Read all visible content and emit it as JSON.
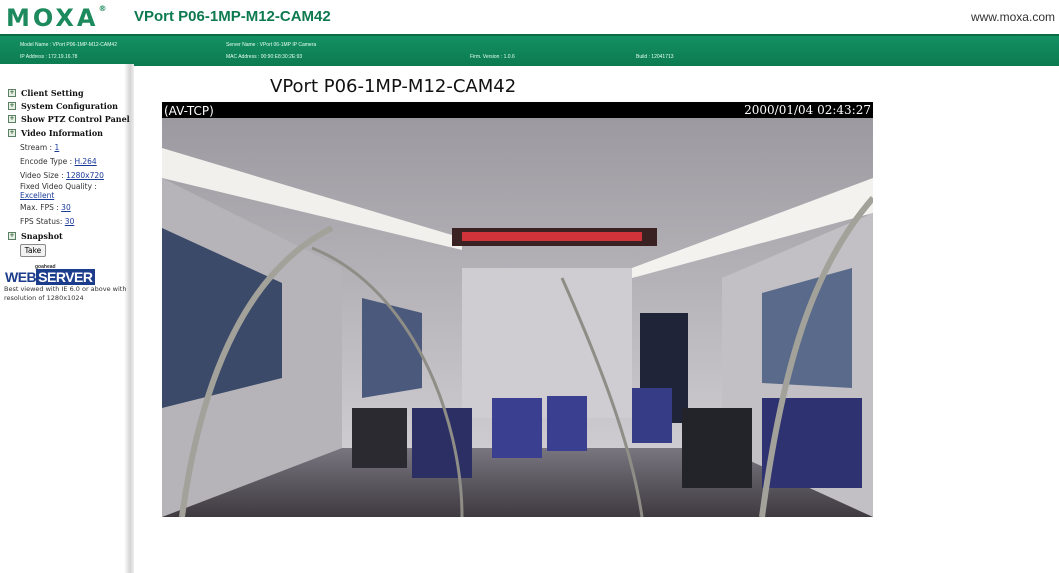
{
  "header": {
    "logo": "MOXA",
    "title": "VPort P06-1MP-M12-CAM42",
    "url": "www.moxa.com"
  },
  "info_bar": {
    "model_name": "Model Name : VPort P06-1MP-M12-CAM42",
    "ip_address": "IP Address : 172.19.16.78",
    "server_name": "Server Name : VPort 06-1MP IP Camera",
    "mac_address": "MAC Address : 00:90:E8:30:2E:93",
    "firm_version": "Firm. Version : 1.0.6",
    "build": "Build : 12041713"
  },
  "sidebar": {
    "client_setting": "Client Setting",
    "system_configuration": "System Configuration",
    "show_ptz": "Show PTZ Control Panel",
    "video_information": "Video Information",
    "stream_label": "Stream : ",
    "stream_value": "1",
    "encode_label": "Encode Type : ",
    "encode_value": "H.264",
    "size_label": "Video Size : ",
    "size_value": "1280x720",
    "quality_label": "Fixed Video Quality :",
    "quality_value": "Excellent",
    "maxfps_label": "Max. FPS : ",
    "maxfps_value": "30",
    "fpsstatus_label": "FPS Status: ",
    "fpsstatus_value": "30",
    "snapshot": "Snapshot",
    "take_button": "Take",
    "webserver_small": "goahead",
    "webserver_web": "WEB",
    "webserver_server": "SERVER",
    "best_viewed": "Best viewed with IE 6.0 or above with resolution of 1280x1024"
  },
  "main": {
    "camera_title": "VPort P06-1MP-M12-CAM42",
    "overlay_protocol": "(AV-TCP)",
    "overlay_timestamp": "2000/01/04 02:43:27"
  },
  "colors": {
    "brand_green": "#0c7b50",
    "link_blue": "#1a3a9a"
  }
}
